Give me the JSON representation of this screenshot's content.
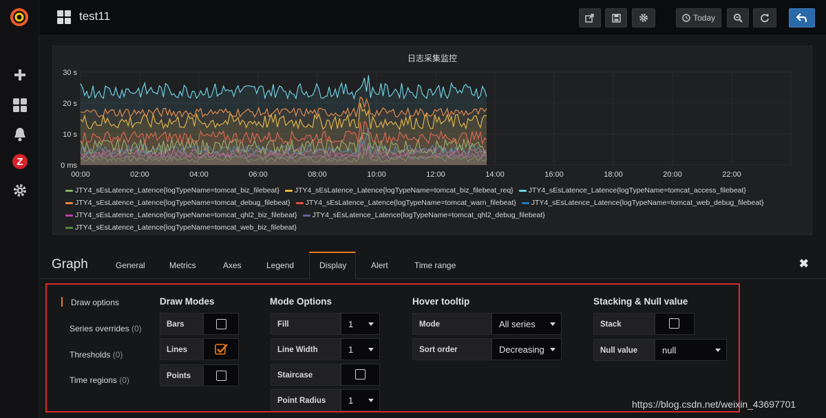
{
  "dashboard": {
    "title": "test11"
  },
  "sidemenu": {
    "icons": [
      "grafana-logo-icon",
      "plus-icon",
      "dashboards-grid-icon",
      "bell-icon",
      "zabbix-icon",
      "gear-icon"
    ],
    "zabbix_letter": "Z"
  },
  "navbar": {
    "buttons": [
      {
        "name": "share-icon",
        "label": ""
      },
      {
        "name": "save-icon",
        "label": ""
      },
      {
        "name": "settings-icon",
        "label": ""
      },
      {
        "name": "clock-icon",
        "label": "Today"
      },
      {
        "name": "zoom-out-icon",
        "label": ""
      },
      {
        "name": "refresh-icon",
        "label": ""
      },
      {
        "name": "back-icon",
        "label": ""
      }
    ]
  },
  "panel": {
    "title": "日志采集监控",
    "legend": [
      [
        {
          "name": "JTY4_sEsLatence_Latence{logTypeName=tomcat_biz_filebeat}",
          "color": "#7eb26d"
        },
        {
          "name": "JTY4_sEsLatence_Latence{logTypeName=tomcat_biz_filebeat_req}",
          "color": "#eab839"
        },
        {
          "name": "JTY4_sEsLatence_Latence{logTypeName=tomcat_access_filebeat}",
          "color": "#6ed0e0"
        }
      ],
      [
        {
          "name": "JTY4_sEsLatence_Latence{logTypeName=tomcat_debug_filebeat}",
          "color": "#ef843c"
        },
        {
          "name": "JTY4_sEsLatence_Latence{logTypeName=tomcat_warn_filebeat}",
          "color": "#e24d42"
        },
        {
          "name": "JTY4_sEsLatence_Latence{logTypeName=tomcat_web_debug_filebeat}",
          "color": "#1f78c1"
        }
      ],
      [
        {
          "name": "JTY4_sEsLatence_Latence{logTypeName=tomcat_qhl2_biz_filebeat}",
          "color": "#ba43a9"
        },
        {
          "name": "JTY4_sEsLatence_Latence{logTypeName=tomcat_qhl2_debug_filebeat}",
          "color": "#705da0"
        }
      ],
      [
        {
          "name": "JTY4_sEsLatence_Latence{logTypeName=tomcat_web_biz_filebeat}",
          "color": "#508642"
        }
      ]
    ]
  },
  "chart_data": {
    "type": "line",
    "title": "日志采集监控",
    "y_ticks": [
      "0 ms",
      "10 s",
      "20 s",
      "30 s"
    ],
    "ylim": [
      0,
      30
    ],
    "x_ticks": [
      "00:00",
      "02:00",
      "04:00",
      "06:00",
      "08:00",
      "10:00",
      "12:00",
      "14:00",
      "16:00",
      "18:00",
      "20:00",
      "22:00"
    ],
    "xlim_hours": [
      0,
      24
    ],
    "data_end_hour": 13.75,
    "grid": true,
    "fill": true,
    "series": [
      {
        "name": "JTY4_sEsLatence_Latence{logTypeName=tomcat_access_filebeat}",
        "color": "#6ed0e0",
        "level": 24,
        "noise": 2.5
      },
      {
        "name": "JTY4_sEsLatence_Latence{logTypeName=tomcat_debug_filebeat}",
        "color": "#ef843c",
        "level": 17,
        "noise": 1.5
      },
      {
        "name": "JTY4_sEsLatence_Latence{logTypeName=tomcat_biz_filebeat_req}",
        "color": "#eab839",
        "level": 14,
        "noise": 2.5
      },
      {
        "name": "JTY4_sEsLatence_Latence{logTypeName=tomcat_warn_filebeat}",
        "color": "#e24d42",
        "level": 9,
        "noise": 2
      },
      {
        "name": "JTY4_sEsLatence_Latence{logTypeName=tomcat_biz_filebeat}",
        "color": "#7eb26d",
        "level": 6,
        "noise": 2.5
      },
      {
        "name": "JTY4_sEsLatence_Latence{logTypeName=tomcat_web_debug_filebeat}",
        "color": "#1f78c1",
        "level": 5,
        "noise": 1.5
      },
      {
        "name": "JTY4_sEsLatence_Latence{logTypeName=tomcat_qhl2_biz_filebeat}",
        "color": "#ba43a9",
        "level": 4,
        "noise": 1.5
      },
      {
        "name": "JTY4_sEsLatence_Latence{logTypeName=tomcat_qhl2_debug_filebeat}",
        "color": "#705da0",
        "level": 3,
        "noise": 1
      },
      {
        "name": "JTY4_sEsLatence_Latence{logTypeName=tomcat_web_biz_filebeat}",
        "color": "#508642",
        "level": 2,
        "noise": 1
      }
    ]
  },
  "editor": {
    "title": "Graph",
    "tabs": [
      "General",
      "Metrics",
      "Axes",
      "Legend",
      "Display",
      "Alert",
      "Time range"
    ],
    "active_tab": "Display",
    "close": "✖"
  },
  "display": {
    "subnav": [
      {
        "label": "Draw options",
        "count": ""
      },
      {
        "label": "Series overrides",
        "count": "(0)"
      },
      {
        "label": "Thresholds",
        "count": "(0)"
      },
      {
        "label": "Time regions",
        "count": "(0)"
      }
    ],
    "draw_modes": {
      "heading": "Draw Modes",
      "bars_label": "Bars",
      "bars_checked": false,
      "lines_label": "Lines",
      "lines_checked": true,
      "points_label": "Points",
      "points_checked": false
    },
    "mode_options": {
      "heading": "Mode Options",
      "fill_label": "Fill",
      "fill_value": "1",
      "line_width_label": "Line Width",
      "line_width_value": "1",
      "staircase_label": "Staircase",
      "staircase_checked": false,
      "point_radius_label": "Point Radius",
      "point_radius_value": "1"
    },
    "hover_tooltip": {
      "heading": "Hover tooltip",
      "mode_label": "Mode",
      "mode_value": "All series",
      "sort_label": "Sort order",
      "sort_value": "Decreasing"
    },
    "stacking": {
      "heading": "Stacking & Null value",
      "stack_label": "Stack",
      "stack_checked": false,
      "null_label": "Null value",
      "null_value": "null"
    }
  },
  "watermark": "https://blog.csdn.net/weixin_43697701"
}
